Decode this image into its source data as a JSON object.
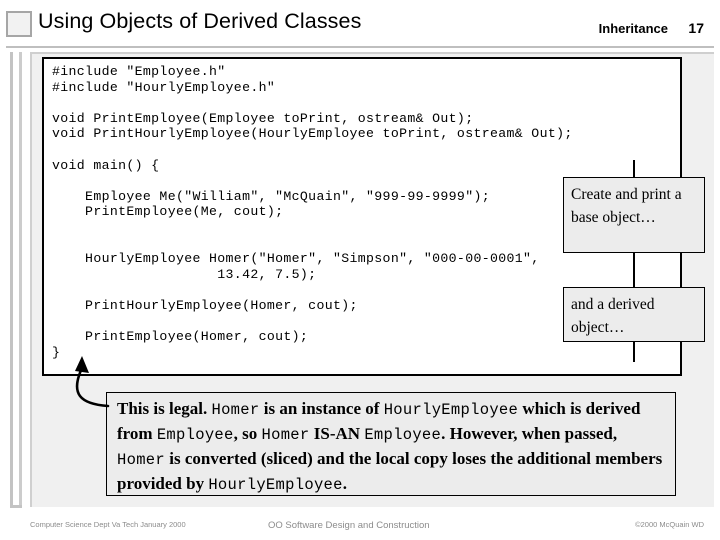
{
  "header": {
    "title": "Using Objects of Derived Classes",
    "subject": "Inheritance",
    "slide_number": "17"
  },
  "code": {
    "text": "#include \"Employee.h\"\n#include \"HourlyEmployee.h\"\n\nvoid PrintEmployee(Employee toPrint, ostream& Out);\nvoid PrintHourlyEmployee(HourlyEmployee toPrint, ostream& Out);\n\nvoid main() {\n\n    Employee Me(\"William\", \"McQuain\", \"999-99-9999\");\n    PrintEmployee(Me, cout);\n\n\n    HourlyEmployee Homer(\"Homer\", \"Simpson\", \"000-00-0001\",\n                    13.42, 7.5);\n\n    PrintHourlyEmployee(Homer, cout);\n\n    PrintEmployee(Homer, cout);\n}"
  },
  "callouts": {
    "base": "Create and print a base object…",
    "derived": "and a derived object…",
    "explanation": {
      "part1": "This is legal. ",
      "code1": "Homer",
      "part2": " is an instance of ",
      "code2": "HourlyEmployee",
      "part3": " which is derived from ",
      "code3": "Employee",
      "part4": ", so ",
      "code4": "Homer",
      "part5": " IS-AN ",
      "code5": "Employee",
      "part6": ". However, when passed, ",
      "code6": "Homer",
      "part7": " is converted (sliced) and the local copy loses the additional members provided by ",
      "code7": "HourlyEmployee",
      "part8": "."
    }
  },
  "footer": {
    "left": "Computer Science Dept Va Tech January 2000",
    "center": "OO Software Design and Construction",
    "right": "©2000  McQuain WD"
  },
  "colors": {
    "panel_background": "#f0f0f0",
    "callout_background": "#ececec",
    "code_background": "#ffffff",
    "border": "#000000",
    "footer_text": "#8c8c8c"
  }
}
